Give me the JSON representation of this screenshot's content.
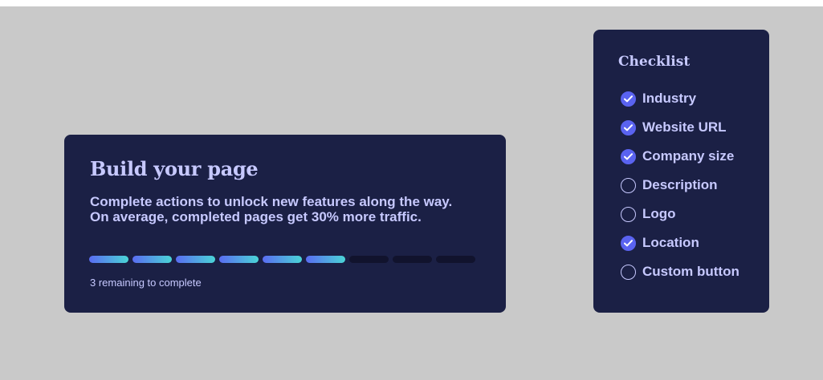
{
  "main_card": {
    "title": "Build your page",
    "description_line1": "Complete actions to unlock new features along the way.",
    "description_line2": "On average, completed pages get 30% more traffic.",
    "progress": {
      "completed_steps": 6,
      "total_steps": 9
    },
    "remaining_text": "3 remaining to complete"
  },
  "checklist": {
    "title": "Checklist",
    "items": [
      {
        "label": "Industry",
        "checked": true
      },
      {
        "label": "Website URL",
        "checked": true
      },
      {
        "label": "Company size",
        "checked": true
      },
      {
        "label": "Description",
        "checked": false
      },
      {
        "label": "Logo",
        "checked": false
      },
      {
        "label": "Location",
        "checked": true
      },
      {
        "label": "Custom button",
        "checked": false
      }
    ]
  },
  "colors": {
    "background": "#c9c9c9",
    "card": "#1b2045",
    "text": "#c7c9ff",
    "accent": "#5a63f0",
    "progress_gradient_start": "#5a6cf2",
    "progress_gradient_end": "#4ad4d6",
    "progress_empty": "#11132d"
  },
  "icons": {
    "checked": "check-circle-icon",
    "unchecked": "empty-circle-icon"
  }
}
